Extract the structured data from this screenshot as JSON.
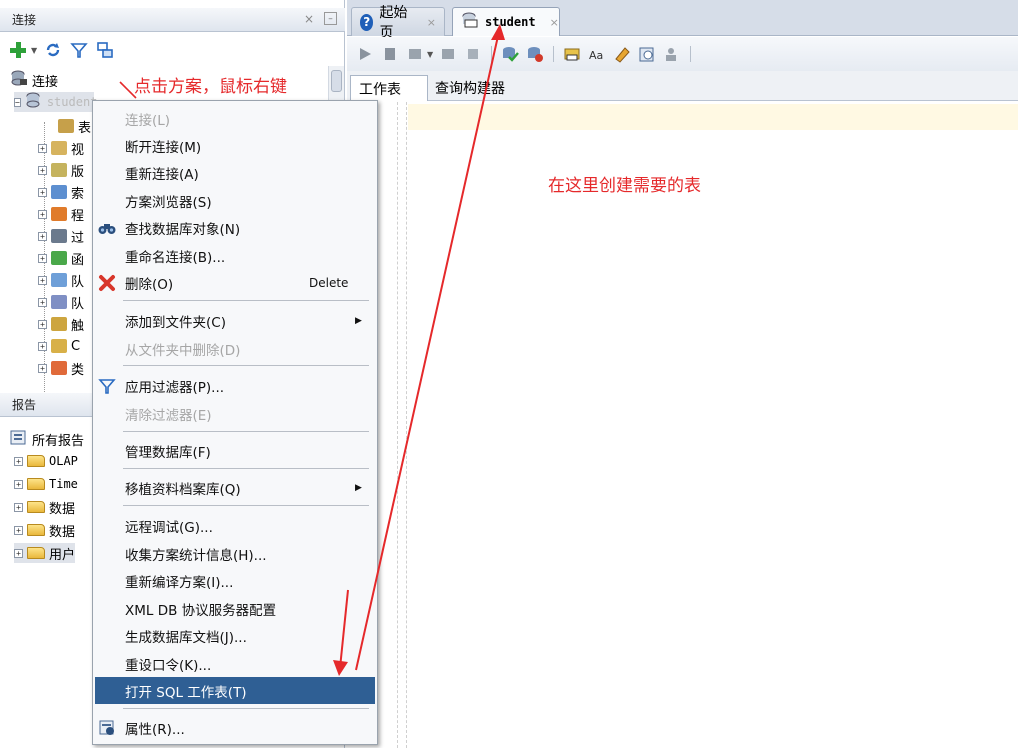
{
  "connections_panel": {
    "title": "连接",
    "root_label": "连接",
    "connection_name": "student",
    "tree_items": [
      "表",
      "视",
      "版",
      "索",
      "程",
      "过",
      "函",
      "队",
      "队",
      "触",
      "C",
      "类"
    ]
  },
  "reports_panel": {
    "title": "报告",
    "root_label": "所有报告",
    "items": [
      "OLAP",
      "Time",
      "数据",
      "数据",
      "用户"
    ]
  },
  "editor_tabs": {
    "start_page": "起始页",
    "student": "student"
  },
  "sub_tabs": {
    "worksheet": "工作表",
    "query_builder": "查询构建器"
  },
  "context_menu": {
    "items": [
      {
        "label": "连接(L)",
        "disabled": true
      },
      {
        "label": "断开连接(M)"
      },
      {
        "label": "重新连接(A)"
      },
      {
        "label": "方案浏览器(S)"
      },
      {
        "label": "查找数据库对象(N)",
        "icon": "binoculars-icon"
      },
      {
        "label": "重命名连接(B)..."
      },
      {
        "label": "删除(O)",
        "icon": "delete-x-icon",
        "shortcut": "Delete"
      },
      {
        "label": "添加到文件夹(C)",
        "submenu": true
      },
      {
        "label": "从文件夹中删除(D)",
        "disabled": true
      },
      {
        "label": "应用过滤器(P)...",
        "icon": "filter-icon"
      },
      {
        "label": "清除过滤器(E)",
        "disabled": true
      },
      {
        "label": "管理数据库(F)"
      },
      {
        "label": "移植资料档案库(Q)",
        "submenu": true
      },
      {
        "label": "远程调试(G)..."
      },
      {
        "label": "收集方案统计信息(H)..."
      },
      {
        "label": "重新编译方案(I)..."
      },
      {
        "label": "XML DB 协议服务器配置"
      },
      {
        "label": "生成数据库文档(J)..."
      },
      {
        "label": "重设口令(K)..."
      },
      {
        "label": "打开 SQL 工作表(T)",
        "highlighted": true
      },
      {
        "label": "属性(R)...",
        "icon": "properties-icon"
      }
    ]
  },
  "annotations": {
    "right_click_hint": "点击方案，鼠标右键",
    "create_table_hint": "在这里创建需要的表"
  },
  "colors": {
    "annotation_red": "#e5292b",
    "menu_highlight": "#2f5f94",
    "current_line": "#fff9e3"
  }
}
